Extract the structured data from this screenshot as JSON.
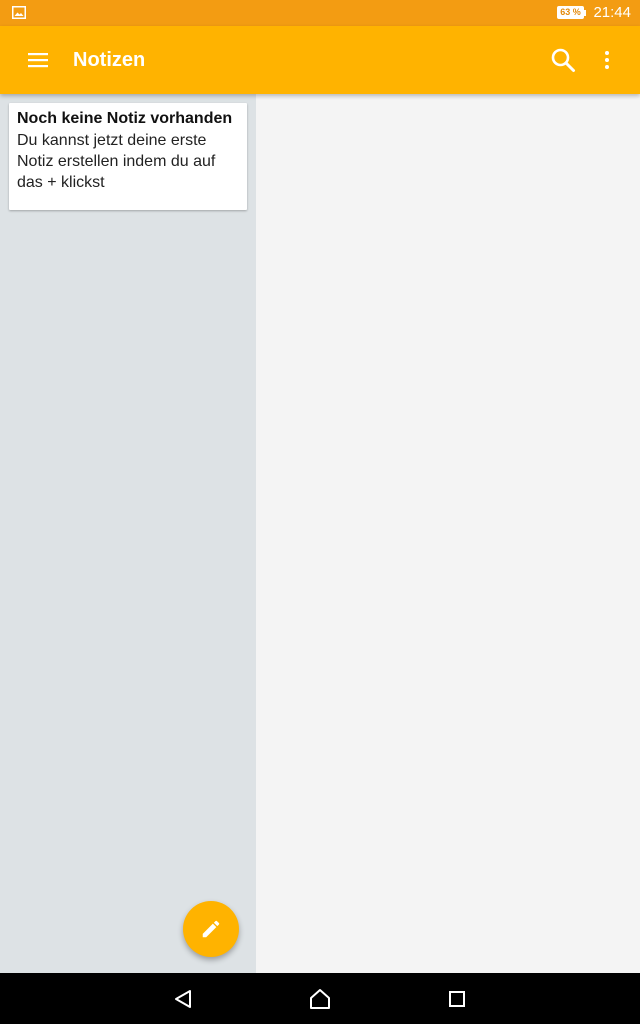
{
  "status_bar": {
    "battery_percent": "63 %",
    "time": "21:44",
    "left_icon": "image-notification-icon",
    "background_color": "#f39c12"
  },
  "app_bar": {
    "title": "Notizen",
    "menu_icon": "hamburger-menu-icon",
    "search_icon": "search-icon",
    "more_icon": "more-vert-icon",
    "background_color": "#ffb300"
  },
  "notes": {
    "items": [
      {
        "title": "Noch keine Notiz vorhanden",
        "body": "Du kannst jetzt deine erste Notiz erstellen indem du auf das + klickst"
      }
    ],
    "pane_color": "#dde2e5"
  },
  "fab": {
    "icon": "pencil-icon",
    "color": "#ffb300"
  },
  "nav_bar": {
    "back_icon": "back-triangle-icon",
    "home_icon": "home-icon",
    "recents_icon": "recents-square-icon"
  }
}
